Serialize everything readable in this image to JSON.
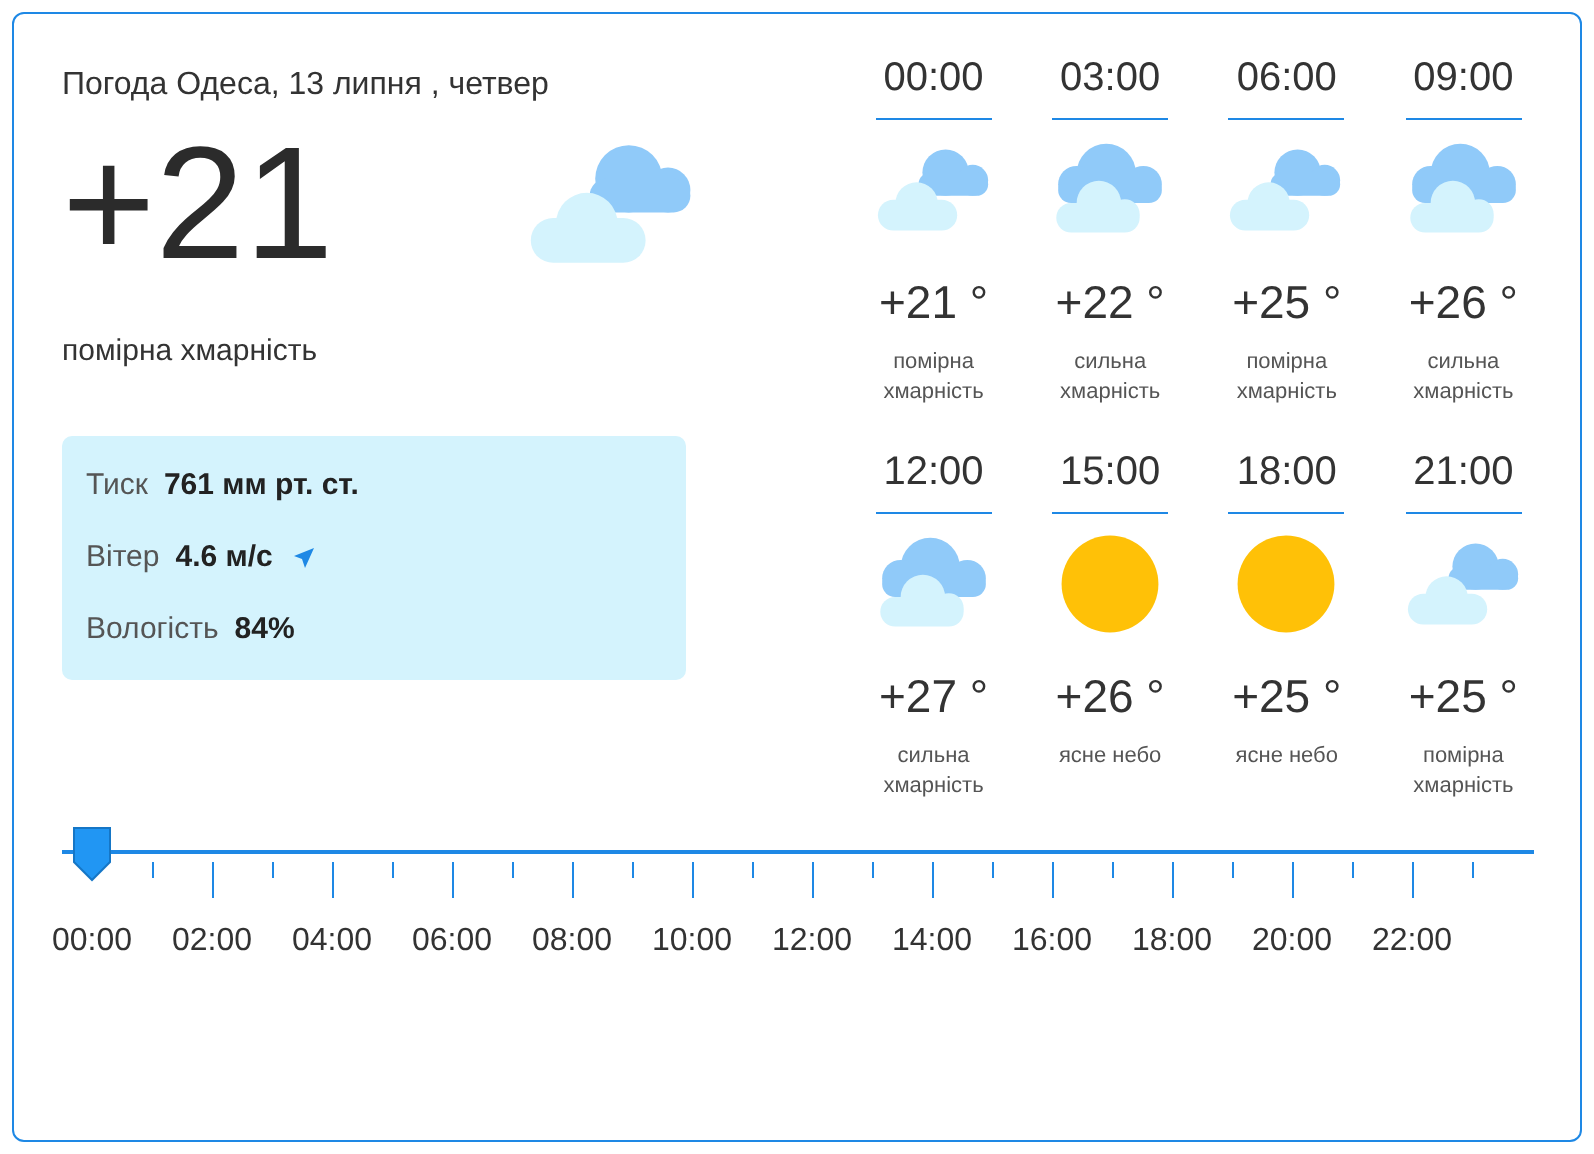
{
  "title": "Погода Одеса, 13 липня , четвер",
  "current": {
    "temperature": "+21",
    "kind": "partly",
    "description": "помірна хмарність"
  },
  "details": [
    {
      "label": "Тиск",
      "value": "761 мм рт. ст.",
      "kind": "plain"
    },
    {
      "label": "Вітер",
      "value": "4.6 м/с",
      "kind": "wind"
    },
    {
      "label": "Вологість",
      "value": "84%",
      "kind": "plain"
    }
  ],
  "forecast": [
    {
      "time": "00:00",
      "kind": "partly",
      "temperature": "+21 °",
      "description": "помірна хмарність"
    },
    {
      "time": "03:00",
      "kind": "cloudy",
      "temperature": "+22 °",
      "description": "сильна хмарність"
    },
    {
      "time": "06:00",
      "kind": "partly",
      "temperature": "+25 °",
      "description": "помірна хмарність"
    },
    {
      "time": "09:00",
      "kind": "cloudy",
      "temperature": "+26 °",
      "description": "сильна хмарність"
    },
    {
      "time": "12:00",
      "kind": "cloudy",
      "temperature": "+27 °",
      "description": "сильна хмарність"
    },
    {
      "time": "15:00",
      "kind": "sun",
      "temperature": "+26 °",
      "description": "ясне небо"
    },
    {
      "time": "18:00",
      "kind": "sun",
      "temperature": "+25 °",
      "description": "ясне небо"
    },
    {
      "time": "21:00",
      "kind": "partly",
      "temperature": "+25 °",
      "description": "помірна хмарність"
    }
  ],
  "timeline": {
    "level": 0,
    "labels": [
      "00:00",
      "02:00",
      "04:00",
      "06:00",
      "08:00",
      "10:00",
      "12:00",
      "14:00",
      "16:00",
      "18:00",
      "20:00",
      "22:00"
    ]
  }
}
